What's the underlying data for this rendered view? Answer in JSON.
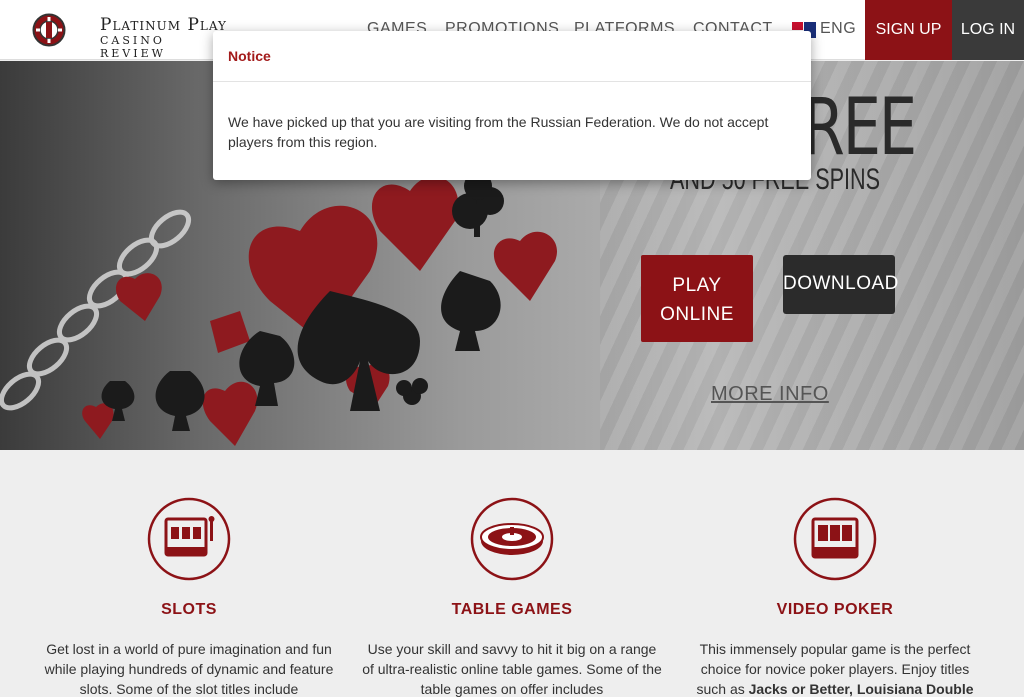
{
  "header": {
    "logo_line1": "Platinum Play",
    "logo_line2": "CASINO REVIEW",
    "nav": {
      "games": "GAMES",
      "promotions": "PROMOTIONS",
      "platforms": "PLATFORMS",
      "contact": "CONTACT",
      "language": "ENG"
    },
    "signup": "SIGN UP",
    "login": "LOG IN"
  },
  "hero": {
    "headline": "FREE",
    "subheadline": "AND 50 FREE SPINS",
    "play_online": "PLAY ONLINE",
    "download": "DOWNLOAD",
    "more_info": "MORE INFO"
  },
  "features": [
    {
      "icon": "slot-machine-icon",
      "title": "SLOTS",
      "text": "Get lost in a world of pure imagination and fun while playing hundreds of dynamic and feature slots. Some of the slot titles include"
    },
    {
      "icon": "roulette-wheel-icon",
      "title": "TABLE GAMES",
      "text": "Use your skill and savvy to hit it big on a range of ultra-realistic online table games. Some of the table games on offer includes"
    },
    {
      "icon": "video-poker-icon",
      "title": "VIDEO POKER",
      "text_plain": "This immensely popular game is the perfect choice for novice poker players. Enjoy titles such as ",
      "text_bold": "Jacks or Better, Louisiana Double"
    }
  ],
  "modal": {
    "title": "Notice",
    "body": "We have picked up that you are visiting from the Russian Federation. We do not accept players from this region."
  },
  "colors": {
    "accent": "#8c1216",
    "dark_button": "#2b2b2b",
    "login_bg": "#3a3a3a",
    "notice_title": "#a31b1b"
  }
}
